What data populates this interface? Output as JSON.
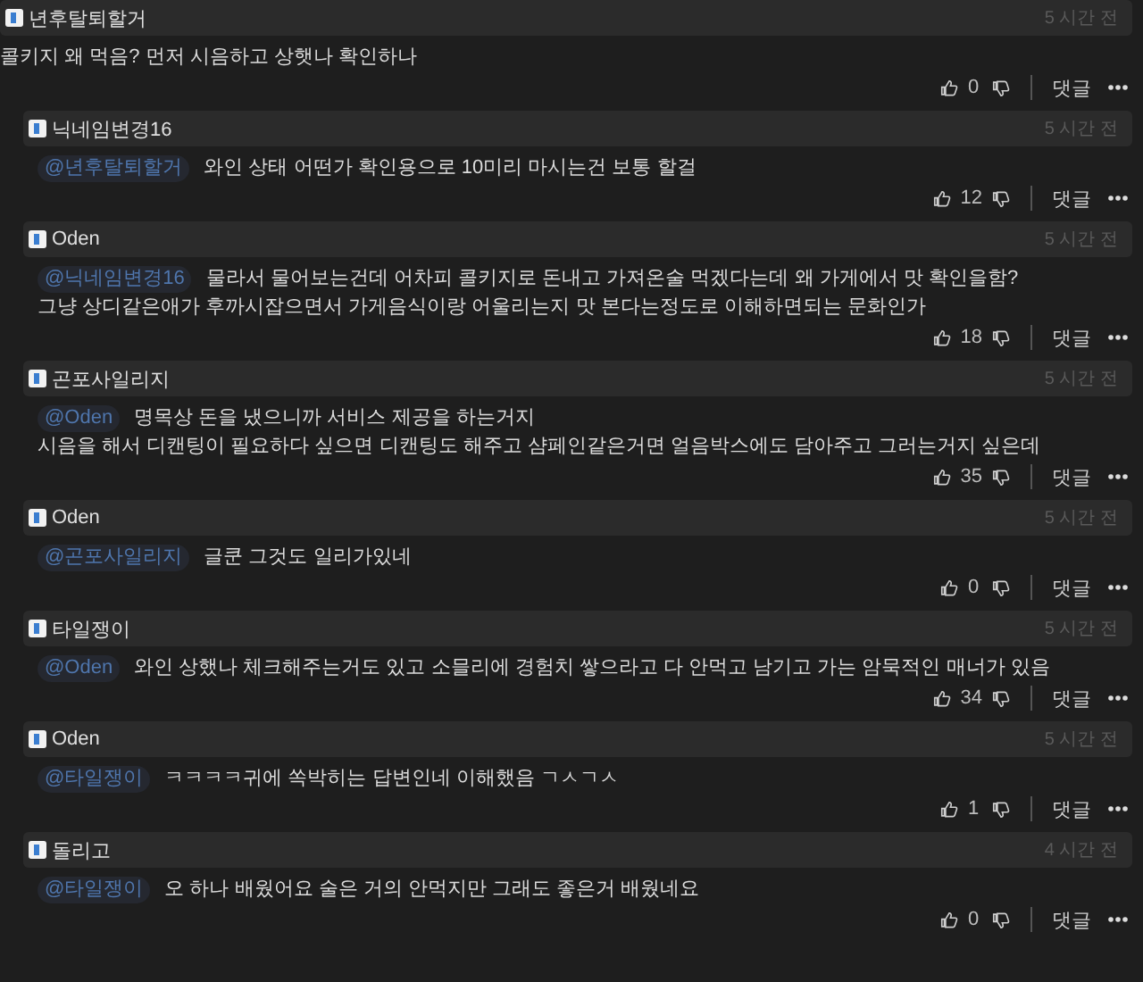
{
  "comments": [
    {
      "kind": "top",
      "author": "년후탈퇴할거",
      "time": "5 시간 전",
      "lines": [
        "콜키지 왜 먹음? 먼저 시음하고 상햇나 확인하나"
      ],
      "likes": "0",
      "reply_label": "댓글"
    },
    {
      "kind": "reply",
      "author": "닉네임변경16",
      "time": "5 시간 전",
      "mention": "@년후탈퇴할거",
      "lines": [
        "와인 상태 어떤가 확인용으로 10미리 마시는건 보통 할걸"
      ],
      "likes": "12",
      "reply_label": "댓글"
    },
    {
      "kind": "reply",
      "author": "Oden",
      "time": "5 시간 전",
      "mention": "@닉네임변경16",
      "lines": [
        "물라서 물어보는건데 어차피 콜키지로 돈내고 가져온술 먹겠다는데 왜 가게에서 맛 확인을함?",
        "그냥 상디같은애가 후까시잡으면서 가게음식이랑 어울리는지 맛 본다는정도로 이해하면되는 문화인가"
      ],
      "likes": "18",
      "reply_label": "댓글"
    },
    {
      "kind": "reply",
      "author": "곤포사일리지",
      "time": "5 시간 전",
      "mention": "@Oden",
      "lines": [
        "명목상 돈을 냈으니까 서비스 제공을 하는거지",
        "시음을 해서 디캔팅이 필요하다 싶으면 디캔팅도 해주고 샴페인같은거면 얼음박스에도 담아주고 그러는거지 싶은데"
      ],
      "likes": "35",
      "reply_label": "댓글"
    },
    {
      "kind": "reply",
      "author": "Oden",
      "time": "5 시간 전",
      "mention": "@곤포사일리지",
      "lines": [
        "글쿤 그것도 일리가있네"
      ],
      "likes": "0",
      "reply_label": "댓글"
    },
    {
      "kind": "reply",
      "author": "타일쟁이",
      "time": "5 시간 전",
      "mention": "@Oden",
      "lines": [
        "와인 상했나 체크해주는거도 있고 소믈리에 경험치 쌓으라고 다 안먹고 남기고 가는 암묵적인 매너가 있음"
      ],
      "likes": "34",
      "reply_label": "댓글"
    },
    {
      "kind": "reply",
      "author": "Oden",
      "time": "5 시간 전",
      "mention": "@타일쟁이",
      "lines": [
        "ㅋㅋㅋㅋ귀에 쏙박히는 답변인네 이해했음 ㄱㅅㄱㅅ"
      ],
      "likes": "1",
      "reply_label": "댓글"
    },
    {
      "kind": "reply",
      "author": "돌리고",
      "time": "4 시간 전",
      "mention": "@타일쟁이",
      "lines": [
        "오 하나 배웠어요 술은 거의 안먹지만 그래도 좋은거 배웠네요"
      ],
      "likes": "0",
      "reply_label": "댓글"
    }
  ]
}
